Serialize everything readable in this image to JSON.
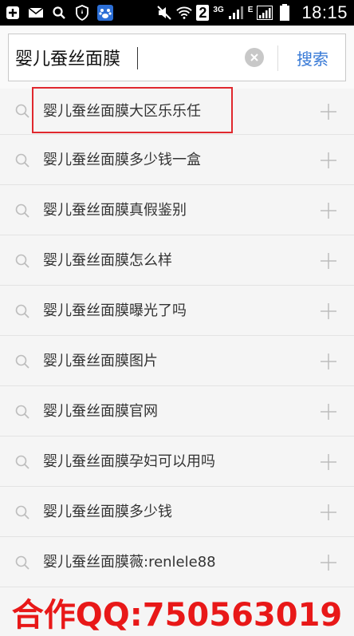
{
  "status_bar": {
    "time": "18:15",
    "sim_badge": "2",
    "network_3g": "3G",
    "network_e": "E",
    "icons": [
      "add-icon",
      "mail-icon",
      "search-icon",
      "shield-icon",
      "paw-icon",
      "mute-icon",
      "wifi-icon",
      "signal-icon",
      "battery-icon"
    ]
  },
  "search": {
    "value": "婴儿蚕丝面膜",
    "button_label": "搜索"
  },
  "suggestions": [
    "婴儿蚕丝面膜大区乐乐任",
    "婴儿蚕丝面膜多少钱一盒",
    "婴儿蚕丝面膜真假鉴别",
    "婴儿蚕丝面膜怎么样",
    "婴儿蚕丝面膜曝光了吗",
    "婴儿蚕丝面膜图片",
    "婴儿蚕丝面膜官网",
    "婴儿蚕丝面膜孕妇可以用吗",
    "婴儿蚕丝面膜多少钱",
    "婴儿蚕丝面膜薇:renlele88"
  ],
  "watermark": "合作QQ:750563019",
  "colors": {
    "accent": "#3779d6",
    "highlight": "#e0282e",
    "watermark": "#e81818"
  }
}
